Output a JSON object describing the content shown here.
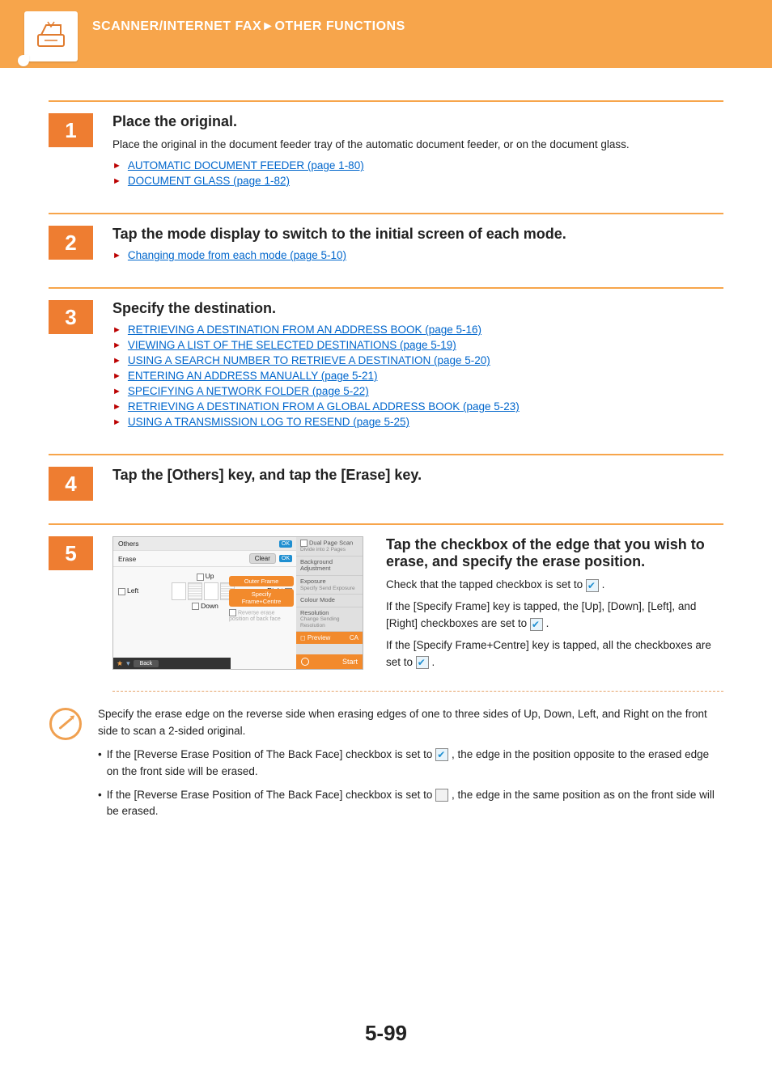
{
  "banner": {
    "breadcrumb": "SCANNER/INTERNET FAX►OTHER FUNCTIONS"
  },
  "steps": [
    {
      "num": "1",
      "title": "Place the original.",
      "desc": "Place the original in the document feeder tray of the automatic document feeder, or on the document glass.",
      "links": [
        "AUTOMATIC DOCUMENT FEEDER (page 1-80)",
        "DOCUMENT GLASS (page 1-82)"
      ]
    },
    {
      "num": "2",
      "title": "Tap the mode display to switch to the initial screen of each mode.",
      "links": [
        "Changing mode from each mode (page 5-10)"
      ]
    },
    {
      "num": "3",
      "title": "Specify the destination.",
      "links": [
        "RETRIEVING A DESTINATION FROM AN ADDRESS BOOK (page 5-16)",
        "VIEWING A LIST OF THE SELECTED DESTINATIONS (page 5-19)",
        "USING A SEARCH NUMBER TO RETRIEVE A DESTINATION (page 5-20)",
        "ENTERING AN ADDRESS MANUALLY (page 5-21)",
        "SPECIFYING A NETWORK FOLDER (page 5-22)",
        "RETRIEVING A DESTINATION FROM A GLOBAL ADDRESS BOOK (page 5-23)",
        "USING A TRANSMISSION LOG TO RESEND (page 5-25)"
      ]
    },
    {
      "num": "4",
      "title": "Tap the [Others] key, and tap the [Erase] key."
    },
    {
      "num": "5",
      "title": "Tap the checkbox of the edge that you wish to erase, and specify the erase position.",
      "body": {
        "p1_before": "Check that the tapped checkbox is set to ",
        "p1_after": " .",
        "p2_before": "If the [Specify Frame] key is tapped, the [Up], [Down], [Left], and [Right] checkboxes are set to ",
        "p2_after": " .",
        "p3_before": "If the [Specify Frame+Centre] key is tapped, all the checkboxes are set to ",
        "p3_after": " ."
      }
    }
  ],
  "ui": {
    "others": "Others",
    "erase": "Erase",
    "clear": "Clear",
    "ok": "OK",
    "up": "Up",
    "down": "Down",
    "left": "Left",
    "right": "Right",
    "outer_frame": "Outer Frame",
    "specify_frame_centre": "Specify Frame+Centre",
    "reverse_back": "Reverse erase position of back face",
    "back": "Back",
    "dual_page": "Dual Page Scan",
    "dual_page_sub": "Divide into 2 Pages",
    "bg_adjust": "Background Adjustment",
    "exposure": "Exposure",
    "exposure_sub": "Specify Send Exposure",
    "colour_mode": "Colour Mode",
    "resolution": "Resolution",
    "resolution_sub": "Change Sending Resolution",
    "preview": "Preview",
    "ca": "CA",
    "start": "Start"
  },
  "note": {
    "intro": "Specify the erase edge on the reverse side when erasing edges of one to three sides of Up, Down, Left, and Right on the front side to scan a 2-sided original.",
    "b1_before": "If the [Reverse Erase Position of The Back Face] checkbox is set to ",
    "b1_after": " , the edge in the position opposite to the erased edge on the front side will be erased.",
    "b2_before": "If the [Reverse Erase Position of The Back Face] checkbox is set to ",
    "b2_after": " , the edge in the same position as on the front side will be erased."
  },
  "page_number": "5-99"
}
